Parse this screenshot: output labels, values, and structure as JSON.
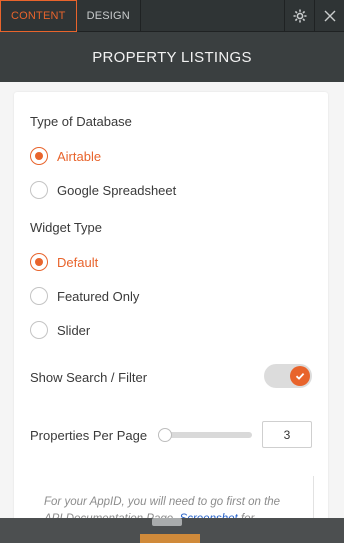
{
  "tabs": {
    "content": "CONTENT",
    "design": "DESIGN"
  },
  "icons": {
    "settings": "gear-icon",
    "close": "close-icon",
    "toggle_check": "check-icon"
  },
  "colors": {
    "accent": "#e8642c",
    "header_bg": "#3a3f40",
    "link": "#2a64c9"
  },
  "header": {
    "title": "PROPERTY LISTINGS"
  },
  "form": {
    "database_label": "Type of Database",
    "database_options": [
      {
        "label": "Airtable",
        "selected": true
      },
      {
        "label": "Google Spreadsheet",
        "selected": false
      }
    ],
    "widget_label": "Widget Type",
    "widget_options": [
      {
        "label": "Default",
        "selected": true
      },
      {
        "label": "Featured Only",
        "selected": false
      },
      {
        "label": "Slider",
        "selected": false
      }
    ],
    "search_filter_label": "Show Search / Filter",
    "search_filter_enabled": true,
    "per_page_label": "Properties Per Page",
    "per_page_value": "3",
    "per_page_slider_level": 0
  },
  "note": {
    "text_before": "For your AppID, you will need to go first on the API Documentation Page. ",
    "link": "Screenshot",
    "text_after": " for"
  }
}
